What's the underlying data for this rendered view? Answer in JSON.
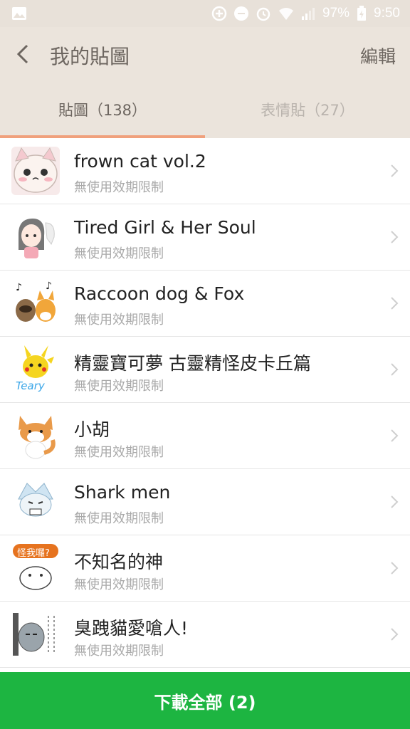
{
  "status_bar": {
    "battery": "97%",
    "time": "9:50"
  },
  "header": {
    "title": "我的貼圖",
    "edit_label": "編輯"
  },
  "tabs": [
    {
      "label": "貼圖（138）",
      "active": true
    },
    {
      "label": "表情貼（27）",
      "active": false
    }
  ],
  "list": [
    {
      "name": "frown cat vol.2",
      "subtitle": "無使用效期限制"
    },
    {
      "name": "Tired Girl & Her Soul",
      "subtitle": "無使用效期限制"
    },
    {
      "name": "Raccoon dog & Fox",
      "subtitle": "無使用效期限制"
    },
    {
      "name": "精靈寶可夢 古靈精怪皮卡丘篇",
      "subtitle": "無使用效期限制",
      "thumb_text": "Teary"
    },
    {
      "name": "小胡",
      "subtitle": "無使用效期限制"
    },
    {
      "name": "Shark men",
      "subtitle": "無使用效期限制"
    },
    {
      "name": "不知名的神",
      "subtitle": "無使用效期限制",
      "thumb_text": "怪我囉?"
    },
    {
      "name": "臭跩貓愛嗆人!",
      "subtitle": "無使用效期限制"
    }
  ],
  "bottom_button": {
    "label": "下載全部 (2)"
  }
}
